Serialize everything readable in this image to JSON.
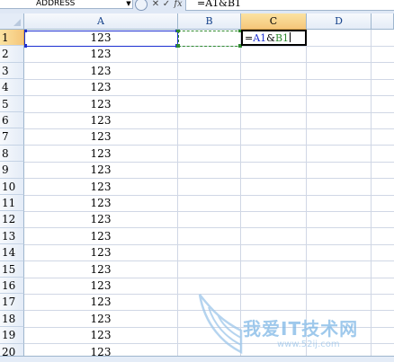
{
  "formula_bar": {
    "name_box": "ADDRESS",
    "fx_symbol": "fx",
    "formula": "=A1&B1"
  },
  "columns": [
    "A",
    "B",
    "C",
    "D"
  ],
  "rows": [
    "1",
    "2",
    "3",
    "4",
    "5",
    "6",
    "7",
    "8",
    "9",
    "10",
    "11",
    "12",
    "13",
    "14",
    "15",
    "16",
    "17",
    "18",
    "19",
    "20"
  ],
  "column_a_values": [
    "123",
    "123",
    "123",
    "123",
    "123",
    "123",
    "123",
    "123",
    "123",
    "123",
    "123",
    "123",
    "123",
    "123",
    "123",
    "123",
    "123",
    "123",
    "123",
    "123"
  ],
  "editing_cell": {
    "prefix": "=",
    "ref1": "A1",
    "op": "&",
    "ref2": "B1"
  },
  "colors": {
    "ref_a": "#1c2fd1",
    "ref_b": "#2f8a2f",
    "header_selected": "#f5c67a"
  },
  "watermark": {
    "title": "我爱IT技术网",
    "url": "www.52ij.com"
  }
}
